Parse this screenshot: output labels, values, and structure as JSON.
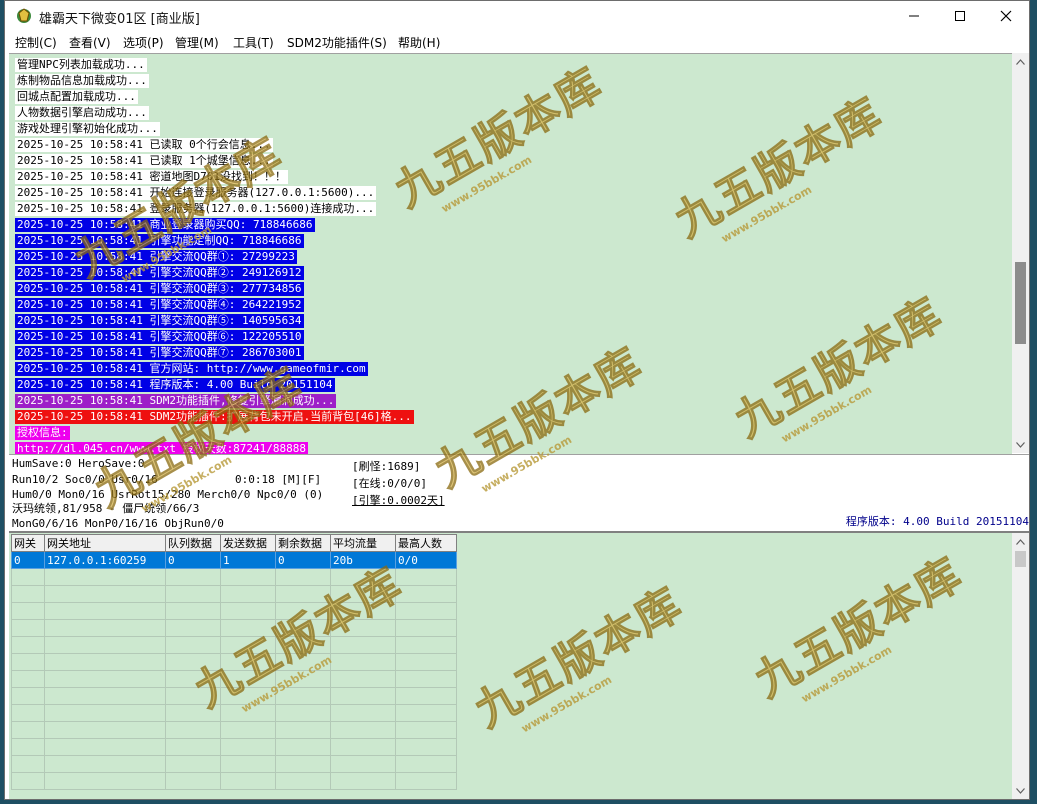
{
  "window": {
    "title": "雄霸天下微变01区 [商业版]"
  },
  "menu": [
    "控制(C)",
    "查看(V)",
    "选项(P)",
    "管理(M)",
    "工具(T)",
    "SDM2功能插件(S)",
    "帮助(H)"
  ],
  "log": [
    {
      "text": "管理NPC列表加载成功...",
      "style": "white"
    },
    {
      "text": "炼制物品信息加载成功...",
      "style": "white"
    },
    {
      "text": "回城点配置加载成功...",
      "style": "white"
    },
    {
      "text": "人物数据引擎启动成功...",
      "style": "white"
    },
    {
      "text": "游戏处理引擎初始化成功...",
      "style": "white"
    },
    {
      "text": "2025-10-25 10:58:41 已读取 0个行会信息...",
      "style": "white"
    },
    {
      "text": "2025-10-25 10:58:41 已读取 1个城堡信息...",
      "style": "white"
    },
    {
      "text": "2025-10-25 10:58:41 密道地图D701没找到！！！",
      "style": "white"
    },
    {
      "text": "2025-10-25 10:58:41 开始连接登录服务器(127.0.0.1:5600)...",
      "style": "white"
    },
    {
      "text": "2025-10-25 10:58:41 登录服务器(127.0.0.1:5600)连接成功...",
      "style": "white"
    },
    {
      "text": "2025-10-25 10:58:41 商业登录器购买QQ: 718846686",
      "style": "blue"
    },
    {
      "text": "2025-10-25 10:58:41 引擎功能定制QQ: 718846686",
      "style": "blue"
    },
    {
      "text": "2025-10-25 10:58:41 引擎交流QQ群①: 27299223",
      "style": "blue"
    },
    {
      "text": "2025-10-25 10:58:41 引擎交流QQ群②: 249126912",
      "style": "blue"
    },
    {
      "text": "2025-10-25 10:58:41 引擎交流QQ群③: 277734856",
      "style": "blue"
    },
    {
      "text": "2025-10-25 10:58:41 引擎交流QQ群④: 264221952",
      "style": "blue"
    },
    {
      "text": "2025-10-25 10:58:41 引擎交流QQ群⑤: 140595634",
      "style": "blue"
    },
    {
      "text": "2025-10-25 10:58:41 引擎交流QQ群⑥: 122205510",
      "style": "blue"
    },
    {
      "text": "2025-10-25 10:58:41 引擎交流QQ群⑦: 286703001",
      "style": "blue"
    },
    {
      "text": "2025-10-25 10:58:41 官方网站: http://www.gameofmir.com",
      "style": "blue"
    },
    {
      "text": "2025-10-25 10:58:41 程序版本: 4.00 Build 20151104",
      "style": "blue"
    },
    {
      "text": "2025-10-25 10:58:41 SDM2功能插件,修复引擎漏洞成功...",
      "style": "purple"
    },
    {
      "text": "2025-10-25 10:58:41 SDM2功能插件:扩展背包未开启.当前背包[46]格...",
      "style": "red"
    },
    {
      "text": "授权信息:",
      "style": "magenta"
    },
    {
      "text": "http://dl.045.cn/www.txt 授权天数:87241/88888",
      "style": "magenta"
    }
  ],
  "status": {
    "line1": "HumSave:0 HeroSave:0",
    "line2": "Run10/2 Soc0/0 Usr0/16",
    "line3": "Hum0/0 Mon0/16 UsrRot15/280 Merch0/0 Npc0/0 (0)",
    "line4": "沃玛统领,81/958 - 僵尸统领/66/3",
    "line5": "MonG0/6/16 MonP0/16/16 ObjRun0/0",
    "timer": "0:0:18 [M][F]",
    "refresh": "[刷怪:1689]",
    "online": "[在线:0/0/0]",
    "engine": "[引擎:0.0002天]",
    "version": "程序版本: 4.00 Build 20151104"
  },
  "gateway_table": {
    "headers": [
      "网关",
      "网关地址",
      "队列数据",
      "发送数据",
      "剩余数据",
      "平均流量",
      "最高人数"
    ],
    "rows": [
      [
        "0",
        "127.0.0.1:60259",
        "0",
        "1",
        "0",
        "20b",
        "0/0"
      ]
    ]
  },
  "watermark": {
    "big": "九五版本库",
    "small": "www.95bbk.com"
  },
  "colors": {
    "log_bg": "#cce8cf",
    "blue": "#0000e6",
    "purple": "#9d1fc8",
    "red": "#ee1010",
    "magenta": "#ee00ee",
    "selection": "#0078d7"
  }
}
